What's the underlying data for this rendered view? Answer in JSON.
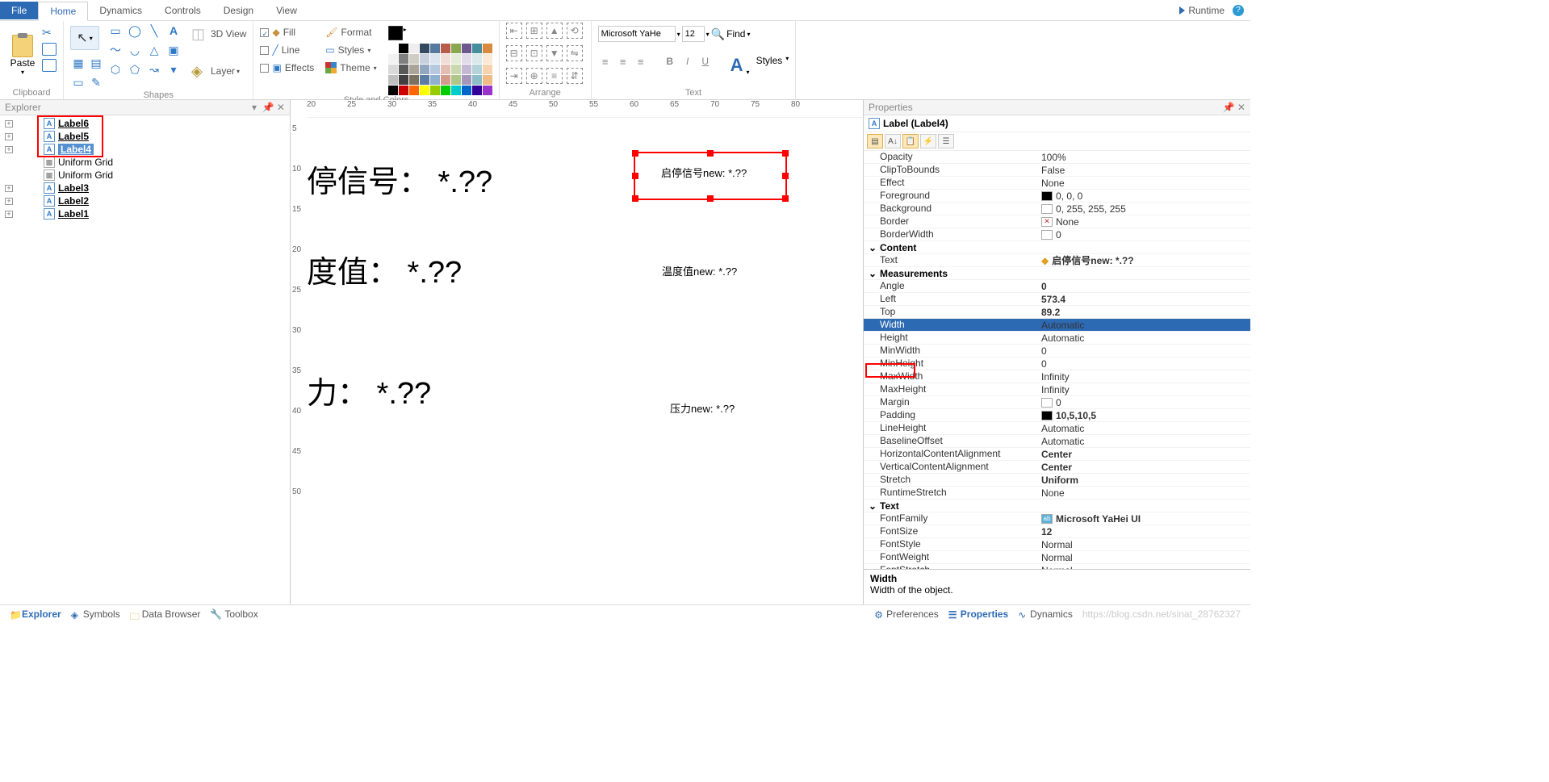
{
  "menu": {
    "file": "File",
    "home": "Home",
    "dynamics": "Dynamics",
    "controls": "Controls",
    "design": "Design",
    "view": "View",
    "runtime": "Runtime"
  },
  "ribbon": {
    "clipboard": "Clipboard",
    "paste": "Paste",
    "shapes": "Shapes",
    "style": "Style and Colors",
    "arrange": "Arrange",
    "text": "Text",
    "view3d": "3D View",
    "layer": "Layer",
    "fill": "Fill",
    "line": "Line",
    "effects": "Effects",
    "format": "Format",
    "styles": "Styles",
    "theme": "Theme",
    "font": "Microsoft YaHe",
    "fontsize": "12",
    "find": "Find",
    "styles2": "Styles"
  },
  "explorer": {
    "title": "Explorer",
    "items": [
      {
        "name": "Label6",
        "type": "label",
        "bold": true,
        "plus": true
      },
      {
        "name": "Label5",
        "type": "label",
        "bold": true,
        "plus": true
      },
      {
        "name": "Label4",
        "type": "label",
        "bold": true,
        "sel": true,
        "plus": true
      },
      {
        "name": "Uniform Grid",
        "type": "grid",
        "bold": false,
        "plus": false
      },
      {
        "name": "Uniform Grid",
        "type": "grid",
        "bold": false,
        "plus": false
      },
      {
        "name": "Label3",
        "type": "label",
        "bold": true,
        "plus": true
      },
      {
        "name": "Label2",
        "type": "label",
        "bold": true,
        "plus": true
      },
      {
        "name": "Label1",
        "type": "label",
        "bold": true,
        "plus": true
      }
    ]
  },
  "rulerH": [
    20,
    25,
    30,
    35,
    40,
    45,
    50,
    55,
    60,
    65,
    70,
    75,
    80
  ],
  "rulerV": [
    5,
    10,
    15,
    20,
    25,
    30,
    35,
    40,
    45,
    50
  ],
  "canvas": {
    "big1": "停信号：  *.??",
    "big2": "度值：  *.??",
    "big3": "力：  *.??",
    "sel": "启停信号new: *.??",
    "s2": "温度值new: *.??",
    "s3": "压力new: *.??"
  },
  "props": {
    "title": "Properties",
    "object": "Label (Label4)",
    "rows": [
      {
        "k": "Opacity",
        "v": "100%"
      },
      {
        "k": "ClipToBounds",
        "v": "False"
      },
      {
        "k": "Effect",
        "v": "None"
      },
      {
        "k": "Foreground",
        "v": "0, 0, 0",
        "sw": "#000"
      },
      {
        "k": "Background",
        "v": "0, 255, 255, 255",
        "sw": "#fff"
      },
      {
        "k": "Border",
        "v": "None",
        "x": true
      },
      {
        "k": "BorderWidth",
        "v": "0",
        "sw": "#fff"
      }
    ],
    "content_cat": "Content",
    "content": [
      {
        "k": "Text",
        "v": "启停信号new: *.??",
        "bold": true,
        "dyn": true
      }
    ],
    "meas_cat": "Measurements",
    "meas": [
      {
        "k": "Angle",
        "v": "0",
        "bold": true
      },
      {
        "k": "Left",
        "v": "573.4",
        "bold": true
      },
      {
        "k": "Top",
        "v": "89.2",
        "bold": true
      },
      {
        "k": "Width",
        "v": "Automatic",
        "sel": true
      },
      {
        "k": "Height",
        "v": "Automatic"
      },
      {
        "k": "MinWidth",
        "v": "0"
      },
      {
        "k": "MinHeight",
        "v": "0"
      },
      {
        "k": "MaxWidth",
        "v": "Infinity"
      },
      {
        "k": "MaxHeight",
        "v": "Infinity"
      },
      {
        "k": "Margin",
        "v": "0",
        "sw": "#fff"
      },
      {
        "k": "Padding",
        "v": "10,5,10,5",
        "bold": true,
        "sw": "#000"
      },
      {
        "k": "LineHeight",
        "v": "Automatic"
      },
      {
        "k": "BaselineOffset",
        "v": "Automatic"
      },
      {
        "k": "HorizontalContentAlignment",
        "v": "Center",
        "bold": true
      },
      {
        "k": "VerticalContentAlignment",
        "v": "Center",
        "bold": true
      },
      {
        "k": "Stretch",
        "v": "Uniform",
        "bold": true
      },
      {
        "k": "RuntimeStretch",
        "v": "None"
      }
    ],
    "text_cat": "Text",
    "text": [
      {
        "k": "FontFamily",
        "v": "Microsoft YaHei UI",
        "bold": true,
        "ab": true
      },
      {
        "k": "FontSize",
        "v": "12",
        "bold": true
      },
      {
        "k": "FontStyle",
        "v": "Normal"
      },
      {
        "k": "FontWeight",
        "v": "Normal"
      },
      {
        "k": "FontStretch",
        "v": "Normal"
      }
    ],
    "desc_title": "Width",
    "desc_body": "Width of the object."
  },
  "status": {
    "explorer": "Explorer",
    "symbols": "Symbols",
    "databrowser": "Data Browser",
    "toolbox": "Toolbox",
    "prefs": "Preferences",
    "props": "Properties",
    "dyn": "Dynamics",
    "url": "https://blog.csdn.net/sinat_28762327"
  },
  "palette": [
    [
      "#fff",
      "#000",
      "#eee",
      "#324b61",
      "#567a9e",
      "#b75c4a",
      "#8aa64e",
      "#6d588f",
      "#458e9e",
      "#d98a3e"
    ],
    [
      "#f2f2f2",
      "#7f7f7f",
      "#d0cdc5",
      "#c7d1de",
      "#dae3ee",
      "#f1ddd8",
      "#e4ebd7",
      "#e0dbe8",
      "#d8e8eb",
      "#fbe8d6"
    ],
    [
      "#d9d9d9",
      "#595959",
      "#aaa499",
      "#91a6bf",
      "#b6c8dd",
      "#e3bcb2",
      "#cad8b0",
      "#c3b9d2",
      "#b3d3d9",
      "#f6d2ae"
    ],
    [
      "#bfbfbf",
      "#404040",
      "#7a7160",
      "#5c7da3",
      "#8fb0cf",
      "#d49a8b",
      "#b0c688",
      "#a596bc",
      "#8dbec7",
      "#f1bb85"
    ],
    [
      "#000",
      "#c00",
      "#f60",
      "#ff0",
      "#9c0",
      "#0c0",
      "#0cc",
      "#06c",
      "#309",
      "#93c"
    ]
  ]
}
